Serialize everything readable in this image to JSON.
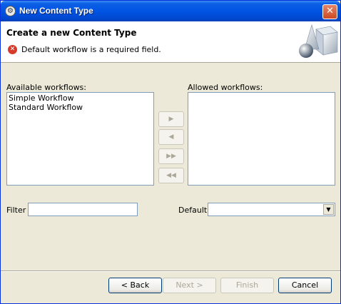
{
  "window": {
    "title": "New Content Type",
    "close_glyph": "✕"
  },
  "header": {
    "title": "Create a new Content Type",
    "error_message": "Default workflow is a required field.",
    "error_icon": "error-icon"
  },
  "available": {
    "label": "Available workflows:",
    "items": [
      "Simple Workflow",
      "Standard Workflow"
    ]
  },
  "allowed": {
    "label": "Allowed workflows:",
    "items": []
  },
  "transfer_buttons": {
    "add": "▶",
    "remove": "◀",
    "add_all": "▶▶",
    "remove_all": "◀◀"
  },
  "filter": {
    "label": "Filter",
    "value": ""
  },
  "default": {
    "label": "Default",
    "value": "",
    "arrow": "▼"
  },
  "buttons": {
    "back": "< Back",
    "next": "Next >",
    "finish": "Finish",
    "cancel": "Cancel"
  },
  "colors": {
    "titlebar": "#0054e3",
    "dialog_bg": "#ece9d8",
    "error": "#d63a2a"
  }
}
